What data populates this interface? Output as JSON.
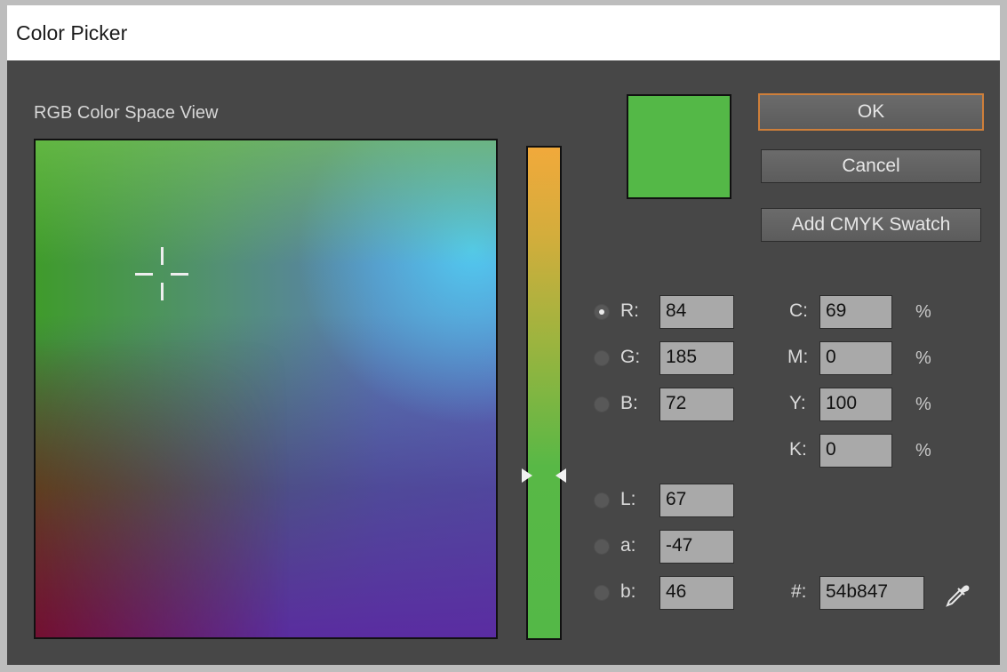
{
  "window": {
    "title": "Color Picker"
  },
  "panel": {
    "section_label": "RGB Color Space View"
  },
  "buttons": {
    "ok": "OK",
    "cancel": "Cancel",
    "add_cmyk_swatch": "Add CMYK Swatch"
  },
  "selected_color": {
    "hex_color": "#54b847"
  },
  "rgb": [
    {
      "label": "R:",
      "value": "84",
      "selected": true
    },
    {
      "label": "G:",
      "value": "185",
      "selected": false
    },
    {
      "label": "B:",
      "value": "72",
      "selected": false
    }
  ],
  "lab": [
    {
      "label": "L:",
      "value": "67",
      "selected": false
    },
    {
      "label": "a:",
      "value": "-47",
      "selected": false
    },
    {
      "label": "b:",
      "value": "46",
      "selected": false
    }
  ],
  "cmyk": [
    {
      "label": "C:",
      "value": "69",
      "unit": "%"
    },
    {
      "label": "M:",
      "value": "0",
      "unit": "%"
    },
    {
      "label": "Y:",
      "value": "100",
      "unit": "%"
    },
    {
      "label": "K:",
      "value": "0",
      "unit": "%"
    }
  ],
  "hex": {
    "label": "#:",
    "value": "54b847"
  },
  "icons": {
    "eyedropper": "eyedropper-icon",
    "crosshair": "crosshair-icon"
  },
  "colors": {
    "accent_ok_border": "#cf7f3a",
    "panel_bg": "#474747"
  }
}
